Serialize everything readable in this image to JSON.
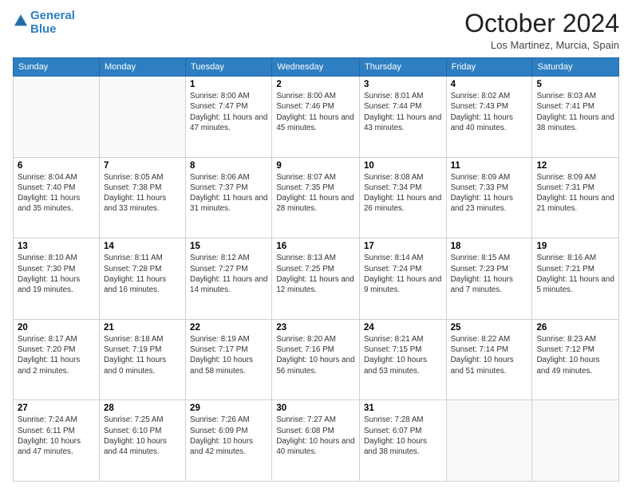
{
  "header": {
    "logo_line1": "General",
    "logo_line2": "Blue",
    "month": "October 2024",
    "location": "Los Martinez, Murcia, Spain"
  },
  "weekdays": [
    "Sunday",
    "Monday",
    "Tuesday",
    "Wednesday",
    "Thursday",
    "Friday",
    "Saturday"
  ],
  "weeks": [
    [
      {
        "day": "",
        "sunrise": "",
        "sunset": "",
        "daylight": ""
      },
      {
        "day": "",
        "sunrise": "",
        "sunset": "",
        "daylight": ""
      },
      {
        "day": "1",
        "sunrise": "Sunrise: 8:00 AM",
        "sunset": "Sunset: 7:47 PM",
        "daylight": "Daylight: 11 hours and 47 minutes."
      },
      {
        "day": "2",
        "sunrise": "Sunrise: 8:00 AM",
        "sunset": "Sunset: 7:46 PM",
        "daylight": "Daylight: 11 hours and 45 minutes."
      },
      {
        "day": "3",
        "sunrise": "Sunrise: 8:01 AM",
        "sunset": "Sunset: 7:44 PM",
        "daylight": "Daylight: 11 hours and 43 minutes."
      },
      {
        "day": "4",
        "sunrise": "Sunrise: 8:02 AM",
        "sunset": "Sunset: 7:43 PM",
        "daylight": "Daylight: 11 hours and 40 minutes."
      },
      {
        "day": "5",
        "sunrise": "Sunrise: 8:03 AM",
        "sunset": "Sunset: 7:41 PM",
        "daylight": "Daylight: 11 hours and 38 minutes."
      }
    ],
    [
      {
        "day": "6",
        "sunrise": "Sunrise: 8:04 AM",
        "sunset": "Sunset: 7:40 PM",
        "daylight": "Daylight: 11 hours and 35 minutes."
      },
      {
        "day": "7",
        "sunrise": "Sunrise: 8:05 AM",
        "sunset": "Sunset: 7:38 PM",
        "daylight": "Daylight: 11 hours and 33 minutes."
      },
      {
        "day": "8",
        "sunrise": "Sunrise: 8:06 AM",
        "sunset": "Sunset: 7:37 PM",
        "daylight": "Daylight: 11 hours and 31 minutes."
      },
      {
        "day": "9",
        "sunrise": "Sunrise: 8:07 AM",
        "sunset": "Sunset: 7:35 PM",
        "daylight": "Daylight: 11 hours and 28 minutes."
      },
      {
        "day": "10",
        "sunrise": "Sunrise: 8:08 AM",
        "sunset": "Sunset: 7:34 PM",
        "daylight": "Daylight: 11 hours and 26 minutes."
      },
      {
        "day": "11",
        "sunrise": "Sunrise: 8:09 AM",
        "sunset": "Sunset: 7:33 PM",
        "daylight": "Daylight: 11 hours and 23 minutes."
      },
      {
        "day": "12",
        "sunrise": "Sunrise: 8:09 AM",
        "sunset": "Sunset: 7:31 PM",
        "daylight": "Daylight: 11 hours and 21 minutes."
      }
    ],
    [
      {
        "day": "13",
        "sunrise": "Sunrise: 8:10 AM",
        "sunset": "Sunset: 7:30 PM",
        "daylight": "Daylight: 11 hours and 19 minutes."
      },
      {
        "day": "14",
        "sunrise": "Sunrise: 8:11 AM",
        "sunset": "Sunset: 7:28 PM",
        "daylight": "Daylight: 11 hours and 16 minutes."
      },
      {
        "day": "15",
        "sunrise": "Sunrise: 8:12 AM",
        "sunset": "Sunset: 7:27 PM",
        "daylight": "Daylight: 11 hours and 14 minutes."
      },
      {
        "day": "16",
        "sunrise": "Sunrise: 8:13 AM",
        "sunset": "Sunset: 7:25 PM",
        "daylight": "Daylight: 11 hours and 12 minutes."
      },
      {
        "day": "17",
        "sunrise": "Sunrise: 8:14 AM",
        "sunset": "Sunset: 7:24 PM",
        "daylight": "Daylight: 11 hours and 9 minutes."
      },
      {
        "day": "18",
        "sunrise": "Sunrise: 8:15 AM",
        "sunset": "Sunset: 7:23 PM",
        "daylight": "Daylight: 11 hours and 7 minutes."
      },
      {
        "day": "19",
        "sunrise": "Sunrise: 8:16 AM",
        "sunset": "Sunset: 7:21 PM",
        "daylight": "Daylight: 11 hours and 5 minutes."
      }
    ],
    [
      {
        "day": "20",
        "sunrise": "Sunrise: 8:17 AM",
        "sunset": "Sunset: 7:20 PM",
        "daylight": "Daylight: 11 hours and 2 minutes."
      },
      {
        "day": "21",
        "sunrise": "Sunrise: 8:18 AM",
        "sunset": "Sunset: 7:19 PM",
        "daylight": "Daylight: 11 hours and 0 minutes."
      },
      {
        "day": "22",
        "sunrise": "Sunrise: 8:19 AM",
        "sunset": "Sunset: 7:17 PM",
        "daylight": "Daylight: 10 hours and 58 minutes."
      },
      {
        "day": "23",
        "sunrise": "Sunrise: 8:20 AM",
        "sunset": "Sunset: 7:16 PM",
        "daylight": "Daylight: 10 hours and 56 minutes."
      },
      {
        "day": "24",
        "sunrise": "Sunrise: 8:21 AM",
        "sunset": "Sunset: 7:15 PM",
        "daylight": "Daylight: 10 hours and 53 minutes."
      },
      {
        "day": "25",
        "sunrise": "Sunrise: 8:22 AM",
        "sunset": "Sunset: 7:14 PM",
        "daylight": "Daylight: 10 hours and 51 minutes."
      },
      {
        "day": "26",
        "sunrise": "Sunrise: 8:23 AM",
        "sunset": "Sunset: 7:12 PM",
        "daylight": "Daylight: 10 hours and 49 minutes."
      }
    ],
    [
      {
        "day": "27",
        "sunrise": "Sunrise: 7:24 AM",
        "sunset": "Sunset: 6:11 PM",
        "daylight": "Daylight: 10 hours and 47 minutes."
      },
      {
        "day": "28",
        "sunrise": "Sunrise: 7:25 AM",
        "sunset": "Sunset: 6:10 PM",
        "daylight": "Daylight: 10 hours and 44 minutes."
      },
      {
        "day": "29",
        "sunrise": "Sunrise: 7:26 AM",
        "sunset": "Sunset: 6:09 PM",
        "daylight": "Daylight: 10 hours and 42 minutes."
      },
      {
        "day": "30",
        "sunrise": "Sunrise: 7:27 AM",
        "sunset": "Sunset: 6:08 PM",
        "daylight": "Daylight: 10 hours and 40 minutes."
      },
      {
        "day": "31",
        "sunrise": "Sunrise: 7:28 AM",
        "sunset": "Sunset: 6:07 PM",
        "daylight": "Daylight: 10 hours and 38 minutes."
      },
      {
        "day": "",
        "sunrise": "",
        "sunset": "",
        "daylight": ""
      },
      {
        "day": "",
        "sunrise": "",
        "sunset": "",
        "daylight": ""
      }
    ]
  ]
}
